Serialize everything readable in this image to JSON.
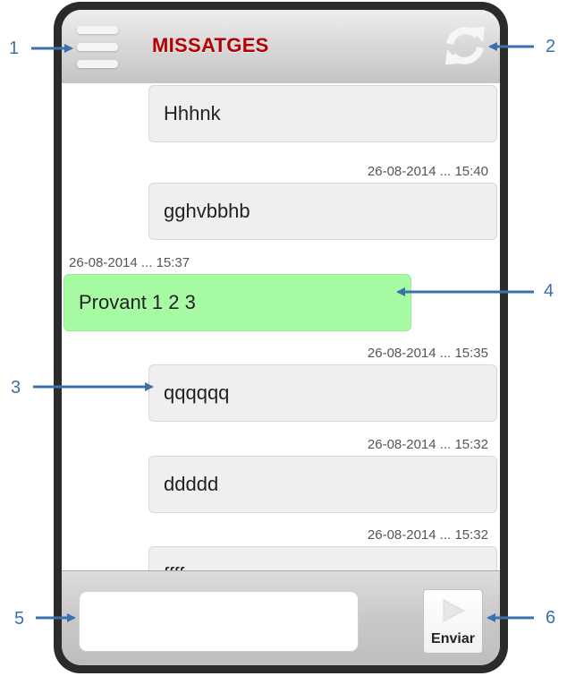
{
  "header": {
    "title": "MISSATGES",
    "title_color": "#b30000",
    "menu_icon": "hamburger-menu-icon",
    "refresh_icon": "refresh-icon"
  },
  "messages": [
    {
      "direction": "out",
      "timestamp": "",
      "text": "Hhhnk"
    },
    {
      "direction": "out",
      "timestamp": "26-08-2014 ... 15:40",
      "text": "gghvbbhb"
    },
    {
      "direction": "in",
      "timestamp": "26-08-2014 ... 15:37",
      "text": "Provant 1 2 3"
    },
    {
      "direction": "out",
      "timestamp": "26-08-2014 ... 15:35",
      "text": "qqqqqq"
    },
    {
      "direction": "out",
      "timestamp": "26-08-2014 ... 15:32",
      "text": "ddddd"
    },
    {
      "direction": "out",
      "timestamp": "26-08-2014 ... 15:32",
      "text": "ffff"
    }
  ],
  "footer": {
    "input_value": "",
    "send_label": "Enviar",
    "send_icon": "play-icon"
  },
  "callouts": [
    "1",
    "2",
    "3",
    "4",
    "5",
    "6"
  ],
  "colors": {
    "incoming_bubble": "#a6fba3",
    "outgoing_bubble": "#efefef",
    "callout_arrow": "#3d6fad"
  }
}
